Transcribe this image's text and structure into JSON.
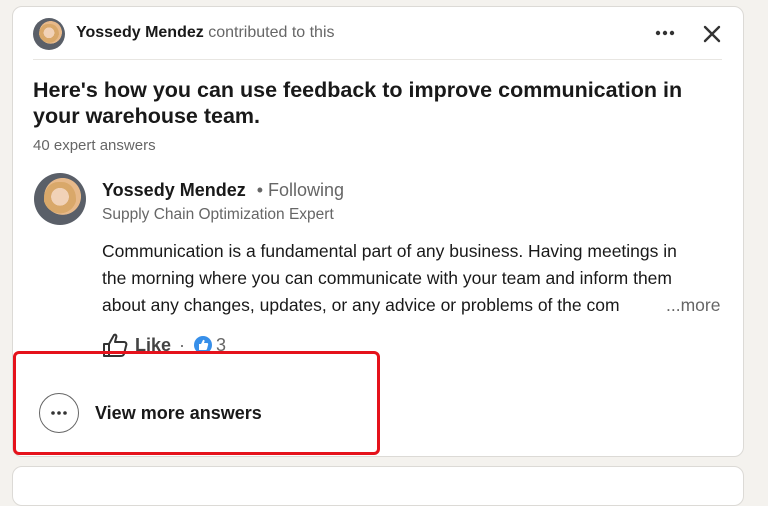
{
  "header": {
    "contributor_name": "Yossedy Mendez",
    "contributor_text": "contributed to this"
  },
  "article": {
    "title": "Here's how you can use feedback to improve communication in your warehouse team.",
    "expert_answers": "40 expert answers"
  },
  "answer": {
    "author_name": "Yossedy Mendez",
    "following": "• Following",
    "author_title": "Supply Chain Optimization Expert",
    "lines": [
      "Communication is a fundamental part of any business. Having meetings in",
      "the morning where you can communicate with your team and inform them",
      "about any changes, updates, or any advice or problems of the com"
    ],
    "more_label": "...more",
    "like_label": "Like",
    "reaction_count": "3"
  },
  "view_more": {
    "label": "View more answers"
  },
  "colors": {
    "highlight": "#e5121b",
    "reaction_blue": "#378fe9"
  }
}
